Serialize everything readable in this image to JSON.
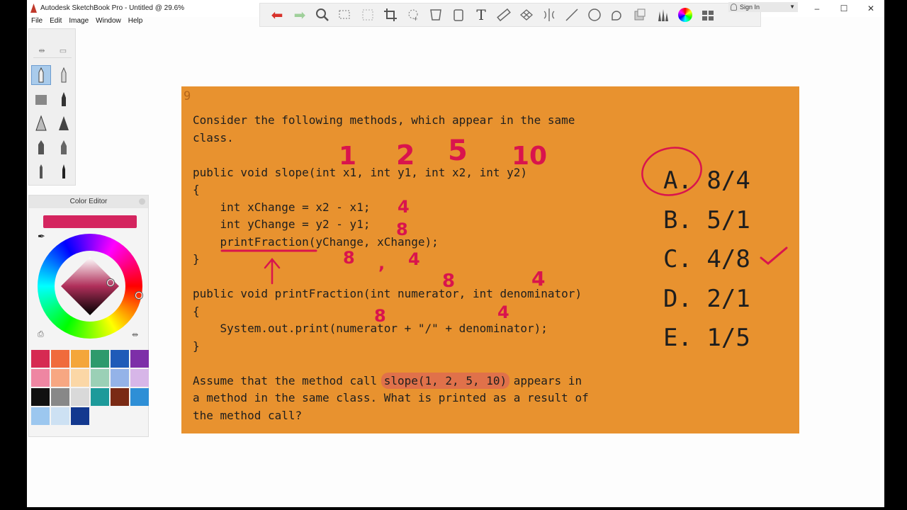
{
  "window": {
    "title": "Autodesk SketchBook Pro - Untitled @ 29.6%",
    "menu": [
      "File",
      "Edit",
      "Image",
      "Window",
      "Help"
    ],
    "sign_in": "Sign In",
    "controls": [
      "–",
      "☐",
      "✕"
    ]
  },
  "toolbar": {
    "icons": [
      "undo-icon",
      "redo-icon",
      "zoom-icon",
      "select-icon",
      "transform-icon",
      "crop-icon",
      "lasso-icon",
      "perspective-icon",
      "bucket-icon",
      "text-icon",
      "ruler-icon",
      "grid-icon",
      "symmetry-icon",
      "stroke-icon",
      "ellipse-icon",
      "french-curve-icon",
      "layer-icon",
      "brush-library-icon",
      "color-wheel-icon",
      "copic-icon"
    ]
  },
  "color_editor": {
    "title": "Color Editor",
    "current_color": "#d4255f",
    "swatches": [
      "#d62a52",
      "#f06b3c",
      "#f4a63a",
      "#2e9a6c",
      "#1f5bb8",
      "#7d2fa8",
      "#ee86a2",
      "#f7a782",
      "#fbd7a6",
      "#9bd0b6",
      "#94b3e8",
      "#d7b6e8",
      "#111111",
      "#888888",
      "#d9d9d9",
      "#1d9a9a",
      "#7a2a14",
      "#2e8fd6",
      "#9cc7ef",
      "#cde1f3",
      "#13388f"
    ]
  },
  "page_number": "9",
  "question": {
    "lines": [
      "Consider the following methods, which appear in the same",
      "class.",
      "",
      "public void slope(int x1, int y1, int x2, int y2)",
      "{",
      "    int xChange = x2 - x1;",
      "    int yChange = y2 - y1;",
      "    printFraction(yChange, xChange);",
      "}",
      "",
      "public void printFraction(int numerator, int denominator)",
      "{",
      "    System.out.print(numerator + \"/\" + denominator);",
      "}",
      "",
      "Assume that the method call ",
      "a method in the same class. What is printed as a result of",
      "the method call?"
    ],
    "highlighted_call": "slope(1, 2, 5, 10)",
    "call_suffix": " appears in"
  },
  "answers": [
    {
      "letter": "A.",
      "value": "8/4"
    },
    {
      "letter": "B.",
      "value": "5/1"
    },
    {
      "letter": "C.",
      "value": "4/8"
    },
    {
      "letter": "D.",
      "value": "2/1"
    },
    {
      "letter": "E.",
      "value": "1/5"
    }
  ],
  "handwriting": {
    "args": [
      "1",
      "2",
      "5",
      "10"
    ],
    "x_change": "4",
    "y_change": "8",
    "call_args": [
      "8",
      ",",
      "4"
    ],
    "param_values": [
      "8",
      "4"
    ],
    "body_values": [
      "8",
      "4"
    ],
    "color": "#d9144d"
  }
}
